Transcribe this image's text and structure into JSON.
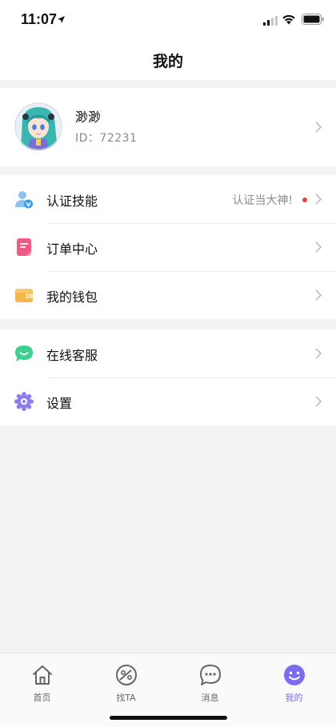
{
  "status_bar": {
    "time": "11:07"
  },
  "nav": {
    "title": "我的"
  },
  "profile": {
    "name": "渺渺",
    "id_label": "ID：72231"
  },
  "menu_group_1": [
    {
      "label": "认证技能",
      "note": "认证当大神!",
      "icon": "verify-skill-icon"
    },
    {
      "label": "订单中心",
      "icon": "order-icon"
    },
    {
      "label": "我的钱包",
      "icon": "wallet-icon"
    }
  ],
  "menu_group_2": [
    {
      "label": "在线客服",
      "icon": "customer-service-icon"
    },
    {
      "label": "设置",
      "icon": "settings-icon"
    }
  ],
  "tabs": [
    {
      "label": "首页",
      "icon": "home-icon",
      "active": false
    },
    {
      "label": "找TA",
      "icon": "planet-icon",
      "active": false
    },
    {
      "label": "消息",
      "icon": "message-icon",
      "active": false
    },
    {
      "label": "我的",
      "icon": "smiley-icon",
      "active": true
    }
  ],
  "colors": {
    "accent": "#7b6cf0",
    "background": "#f3f3f5",
    "notice_dot": "#e9413f"
  }
}
